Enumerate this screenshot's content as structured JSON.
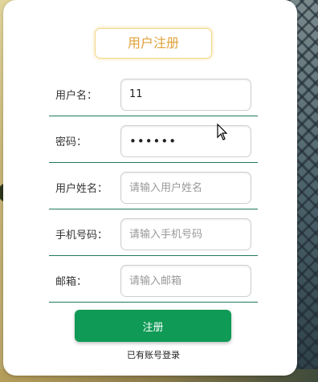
{
  "form": {
    "title": "用户注册",
    "fields": [
      {
        "label": "用户名：",
        "value": "11",
        "placeholder": "",
        "type": "text"
      },
      {
        "label": "密码：",
        "value": "••••••",
        "placeholder": "",
        "type": "password"
      },
      {
        "label": "用户姓名：",
        "value": "",
        "placeholder": "请输入用户姓名",
        "type": "text"
      },
      {
        "label": "手机号码：",
        "value": "",
        "placeholder": "请输入手机号码",
        "type": "text"
      },
      {
        "label": "邮箱：",
        "value": "",
        "placeholder": "请输入邮箱",
        "type": "text"
      }
    ],
    "submit_label": "注册",
    "login_link": "已有账号登录"
  },
  "colors": {
    "accent": "#e0a13a",
    "button": "#0f9a55",
    "divider": "#1e7a5c"
  }
}
